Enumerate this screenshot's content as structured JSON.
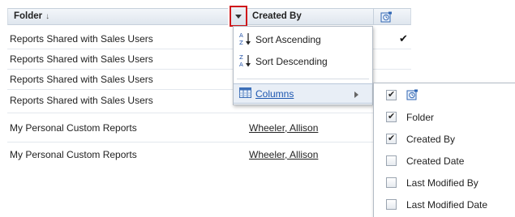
{
  "grid": {
    "headers": {
      "folder": "Folder",
      "folder_sort_indicator": "↓",
      "created_by": "Created By",
      "visibility_icon": "report-type-icon"
    },
    "rows": [
      {
        "folder": "Reports Shared with Sales Users",
        "created_by": "",
        "checked": "✔"
      },
      {
        "folder": "Reports Shared with Sales Users",
        "created_by": "",
        "checked": ""
      },
      {
        "folder": "Reports Shared with Sales Users",
        "created_by": "",
        "checked": ""
      },
      {
        "folder": "Reports Shared with Sales Users",
        "created_by": "",
        "checked": ""
      },
      {
        "folder": "My Personal Custom Reports",
        "created_by": "Wheeler, Allison",
        "checked": ""
      },
      {
        "folder": "My Personal Custom Reports",
        "created_by": "Wheeler, Allison",
        "checked": ""
      }
    ]
  },
  "menu": {
    "sort_ascending": "Sort Ascending",
    "sort_descending": "Sort Descending",
    "columns": "Columns"
  },
  "columns_submenu": {
    "items": [
      {
        "label": "",
        "icon": "report-type-icon",
        "checked": true
      },
      {
        "label": "Folder",
        "checked": true
      },
      {
        "label": "Created By",
        "checked": true
      },
      {
        "label": "Created Date",
        "checked": false
      },
      {
        "label": "Last Modified By",
        "checked": false
      },
      {
        "label": "Last Modified Date",
        "checked": false
      }
    ]
  },
  "colors": {
    "accent_border": "#d0181b",
    "link_active": "#1c56b0",
    "header_bg": "#dfe6ee"
  }
}
